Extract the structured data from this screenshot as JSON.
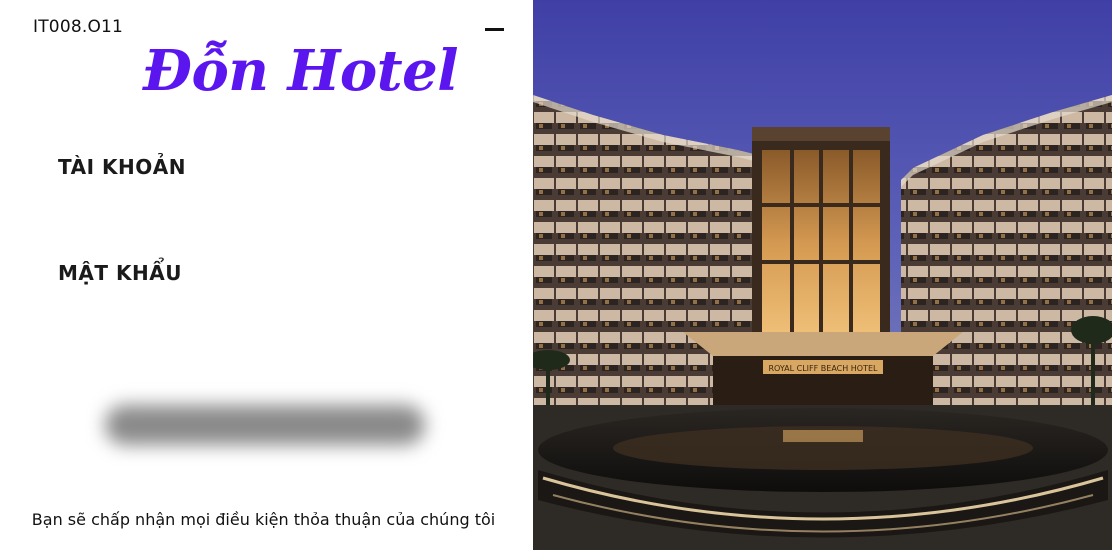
{
  "header": {
    "course_code": "IT008.O11",
    "minimize_icon": "minimize-icon"
  },
  "brand": {
    "name": "Đỗn Hotel",
    "color": "#5b16f0"
  },
  "form": {
    "account_label": "TÀI KHOẢN",
    "account_value": "",
    "password_label": "MẬT KHẨU",
    "password_value": "",
    "login_button_label": ""
  },
  "footer": {
    "terms_text": "Bạn sẽ chấp nhận mọi điều kiện thỏa thuận của chúng tôi"
  },
  "hero_image": {
    "sign_text": "ROYAL CLIFF BEACH HOTEL"
  }
}
